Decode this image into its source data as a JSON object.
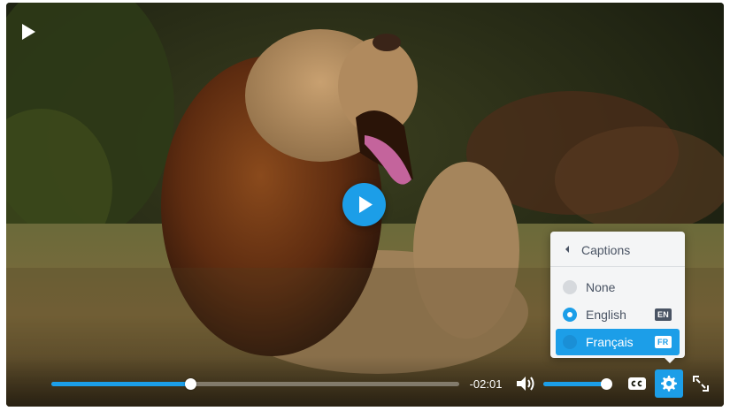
{
  "player": {
    "time_remaining": "-02:01",
    "progress": 0.34,
    "volume": 0.97,
    "accent_color": "#1c9ee8",
    "icons": {
      "big_play": "play-icon",
      "play": "play-icon",
      "volume": "volume-icon",
      "captions": "cc-icon",
      "settings": "gear-icon",
      "fullscreen": "fullscreen-icon"
    }
  },
  "captions_menu": {
    "title": "Captions",
    "options": [
      {
        "label": "None",
        "badge": "",
        "checked": false,
        "selected": false
      },
      {
        "label": "English",
        "badge": "EN",
        "checked": true,
        "selected": false
      },
      {
        "label": "Français",
        "badge": "FR",
        "checked": false,
        "selected": true
      }
    ]
  }
}
